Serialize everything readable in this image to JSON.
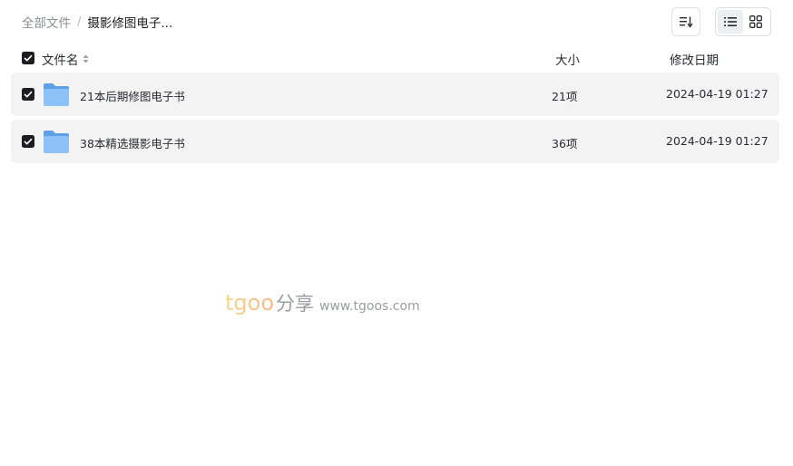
{
  "breadcrumb": {
    "root": "全部文件",
    "separator": "/",
    "current": "摄影修图电子..."
  },
  "toolbar": {
    "sort_icon": "sort-lines-icon",
    "view_options": [
      "list-view-icon",
      "grid-view-icon"
    ],
    "active_view": "list"
  },
  "table": {
    "headers": {
      "name": "文件名",
      "size": "大小",
      "date": "修改日期"
    },
    "rows": [
      {
        "name": "21本后期修图电子书",
        "size": "21项",
        "date": "2024-04-19 01:27",
        "icon": "folder-icon",
        "checked": true
      },
      {
        "name": "38本精选摄影电子书",
        "size": "36项",
        "date": "2024-04-19 01:27",
        "icon": "folder-icon",
        "checked": true
      }
    ]
  },
  "watermark": {
    "brand": "tgoo",
    "brand_cn": "分享",
    "url": "www.tgoos.com"
  },
  "colors": {
    "row_background": "#f3f3f4",
    "checkbox": "#1d1d22",
    "folder": "#7ab6f3",
    "watermark_brand": "#f3c48a"
  }
}
